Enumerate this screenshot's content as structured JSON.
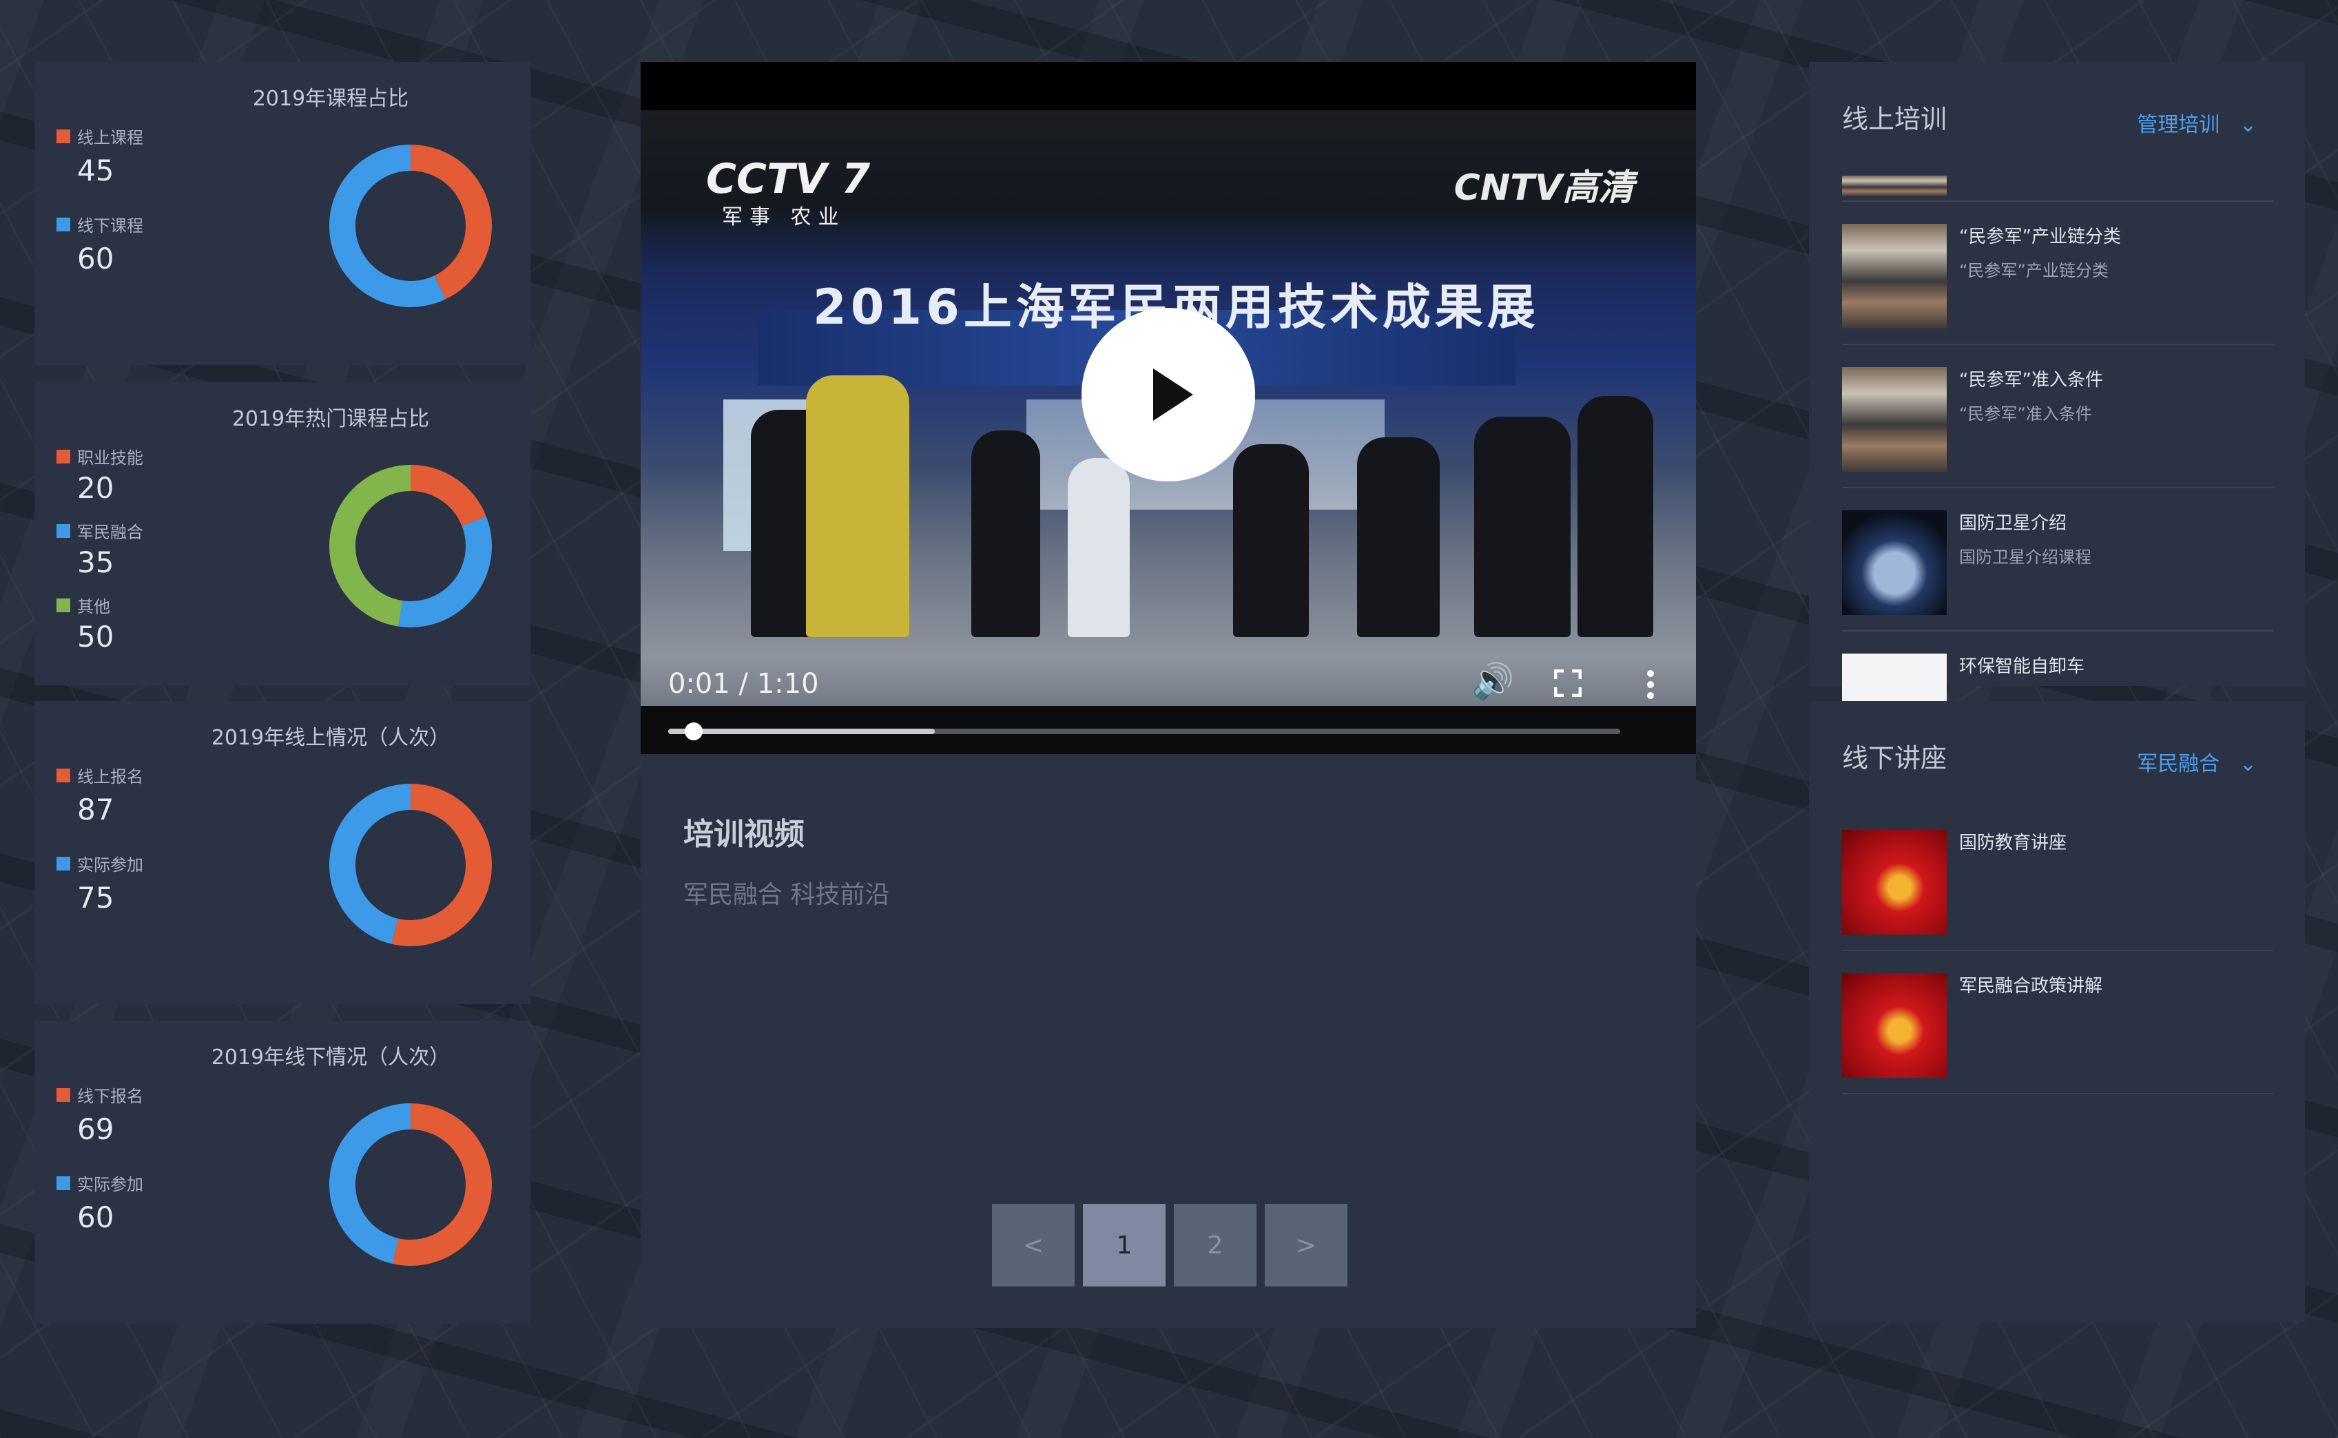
{
  "stats": [
    {
      "title": "2019年课程占比",
      "items": [
        {
          "label": "线上课程",
          "value": 45,
          "color": "#e45c35"
        },
        {
          "label": "线下课程",
          "value": 60,
          "color": "#3d9ae8"
        }
      ]
    },
    {
      "title": "2019年热门课程占比",
      "items": [
        {
          "label": "职业技能",
          "value": 20,
          "color": "#e45c35"
        },
        {
          "label": "军民融合",
          "value": 35,
          "color": "#3d9ae8"
        },
        {
          "label": "其他",
          "value": 50,
          "color": "#82b54b"
        }
      ]
    },
    {
      "title": "2019年线上情况（人次）",
      "items": [
        {
          "label": "线上报名",
          "value": 87,
          "color": "#e45c35"
        },
        {
          "label": "实际参加",
          "value": 75,
          "color": "#3d9ae8"
        }
      ]
    },
    {
      "title": "2019年线下情况（人次）",
      "items": [
        {
          "label": "线下报名",
          "value": 69,
          "color": "#e45c35"
        },
        {
          "label": "实际参加",
          "value": 60,
          "color": "#3d9ae8"
        }
      ]
    }
  ],
  "video": {
    "logo_left": "CCTV 7",
    "logo_left_sub": "军事 农业",
    "logo_right": "CNTV高清",
    "banner": "2016上海军民两用技术成果展",
    "time": "0:01 / 1:10",
    "progress": 0.027,
    "buffered": 0.28,
    "title": "培训视频",
    "subtitle": "军民融合 科技前沿"
  },
  "pager": {
    "prev": "<",
    "pages": [
      "1",
      "2"
    ],
    "active": "1",
    "next": ">"
  },
  "online": {
    "title": "线上培训",
    "select": "管理培训",
    "items": [
      {
        "name": "“民参军”产业链分类",
        "desc": "“民参军”产业链分类",
        "thumb": "conference"
      },
      {
        "name": "“民参军”准入条件",
        "desc": "“民参军”准入条件",
        "thumb": "conference"
      },
      {
        "name": "国防卫星介绍",
        "desc": "国防卫星介绍课程",
        "thumb": "satellite"
      },
      {
        "name": "环保智能自卸车",
        "desc": "",
        "thumb": "vehicle"
      }
    ]
  },
  "offline": {
    "title": "线下讲座",
    "select": "军民融合",
    "items": [
      {
        "name": "国防教育讲座",
        "thumb": "flag"
      },
      {
        "name": "军民融合政策讲解",
        "thumb": "flag"
      }
    ]
  }
}
